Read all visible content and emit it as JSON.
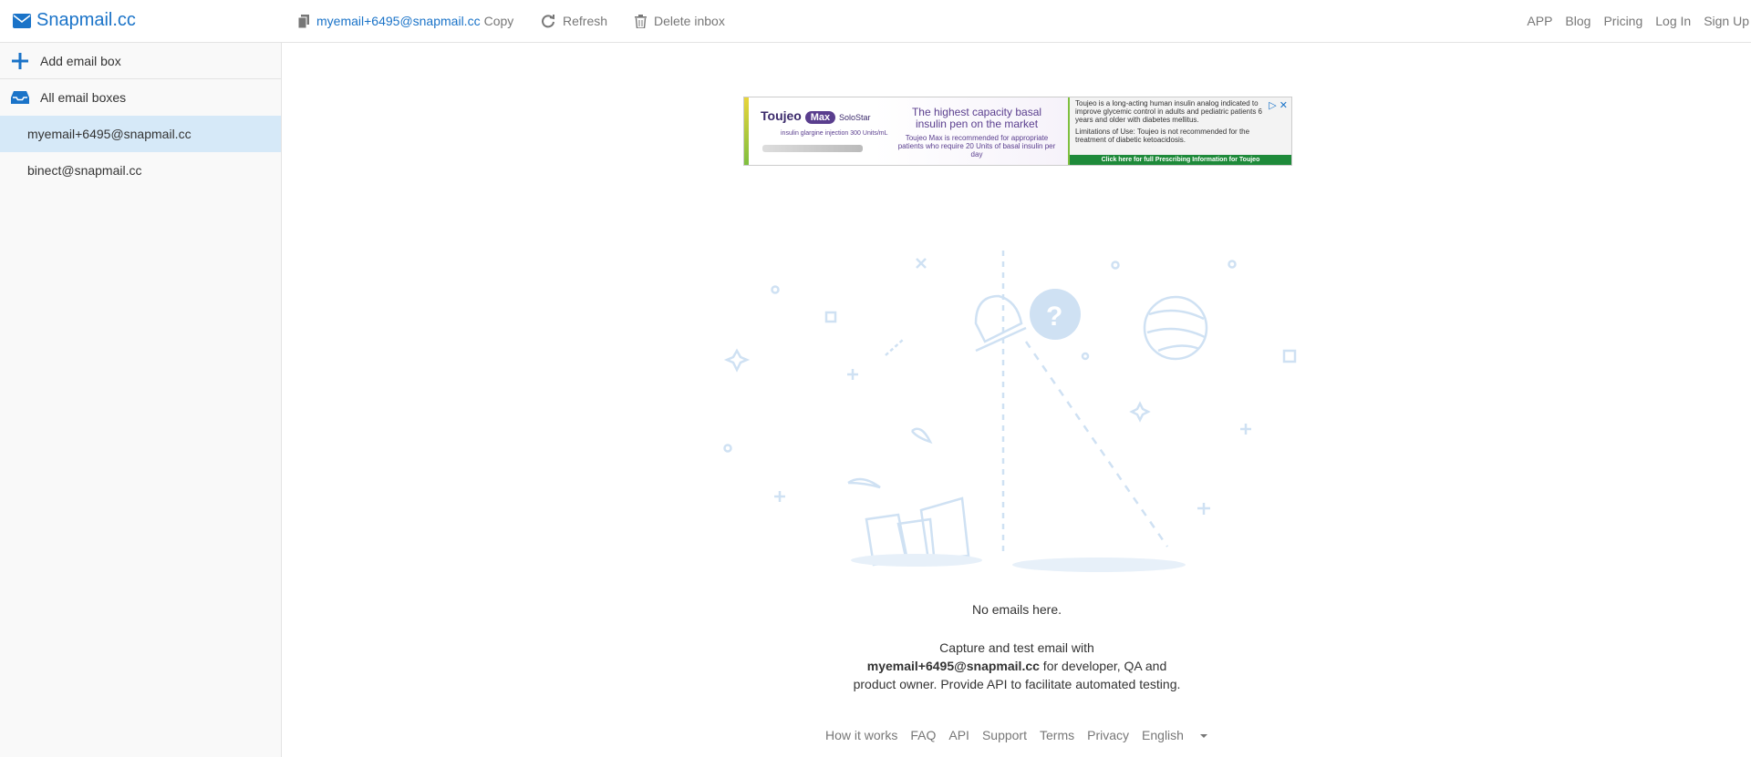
{
  "brand": {
    "name": "Snapmail.cc"
  },
  "toolbar": {
    "current_email": "myemail+6495@snapmail.cc",
    "copy_label": "Copy",
    "refresh_label": "Refresh",
    "delete_label": "Delete inbox"
  },
  "nav": {
    "items": [
      "APP",
      "Blog",
      "Pricing",
      "Log In",
      "Sign Up"
    ]
  },
  "sidebar": {
    "add_label": "Add email box",
    "all_label": "All email boxes",
    "inboxes": [
      "myemail+6495@snapmail.cc",
      "binect@snapmail.cc"
    ]
  },
  "ad": {
    "logo": "Toujeo",
    "max": "Max",
    "solostar": "SoloStar",
    "sub": "insulin glargine injection 300 Units/mL",
    "headline": "The highest capacity basal insulin pen on the market",
    "body": "Toujeo Max is recommended for appropriate patients who require 20 Units of basal insulin per day",
    "right_text_1": "Toujeo is a long-acting human insulin analog indicated to improve glycemic control in adults and pediatric patients 6 years and older with diabetes mellitus.",
    "right_text_2": "Limitations of Use: Toujeo is not recommended for the treatment of diabetic ketoacidosis.",
    "footer": "Click here for full Prescribing Information for Toujeo"
  },
  "empty": {
    "title": "No emails here.",
    "line1": "Capture and test email with",
    "email_bold": "myemail+6495@snapmail.cc",
    "line2_rest": " for developer, QA and",
    "line3": "product owner. Provide API to facilitate automated testing."
  },
  "footer": {
    "links": [
      "How it works",
      "FAQ",
      "API",
      "Support",
      "Terms",
      "Privacy"
    ],
    "language": "English"
  },
  "colors": {
    "accent": "#1a73c8",
    "active_row": "#d6e9f8",
    "illustration": "#cfe1f3"
  }
}
